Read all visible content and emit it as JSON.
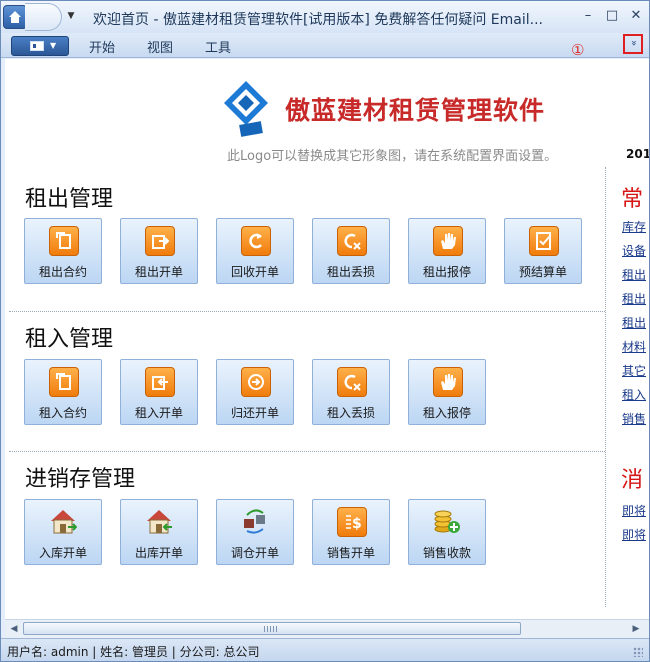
{
  "window": {
    "title": "欢迎首页 - 傲蓝建材租赁管理软件[试用版本] 免费解答任何疑问 Email...",
    "minimize_glyph": "–",
    "maximize_glyph": "□",
    "close_glyph": "✕"
  },
  "ribbon": {
    "tabs": [
      "开始",
      "视图",
      "工具"
    ],
    "callout": "①",
    "collapse_glyph": "»"
  },
  "logo": {
    "title": "傲蓝建材租赁管理软件",
    "subtitle": "此Logo可以替换成其它形象图，请在系统配置界面设置。",
    "year_fragment": "201"
  },
  "sections": [
    {
      "title": "租出管理",
      "items": [
        "租出合约",
        "租出开单",
        "回收开单",
        "租出丢损",
        "租出报停",
        "预结算单"
      ]
    },
    {
      "title": "租入管理",
      "items": [
        "租入合约",
        "租入开单",
        "归还开单",
        "租入丢损",
        "租入报停"
      ]
    },
    {
      "title": "进销存管理",
      "items": [
        "入库开单",
        "出库开单",
        "调仓开单",
        "销售开单",
        "销售收款"
      ]
    }
  ],
  "right_panel": {
    "heading1": "常",
    "links1": [
      "库存",
      "设备",
      "租出",
      "租出",
      "租出",
      "材料",
      "其它",
      "租入",
      "销售"
    ],
    "heading2": "消",
    "links2": [
      "即将",
      "即将"
    ]
  },
  "status": {
    "text": "用户名: admin  | 姓名: 管理员  | 分公司: 总公司"
  },
  "colors": {
    "accent_orange": "#f07c0c",
    "brand_red": "#c82a2a",
    "link_blue": "#1a3a8a"
  }
}
